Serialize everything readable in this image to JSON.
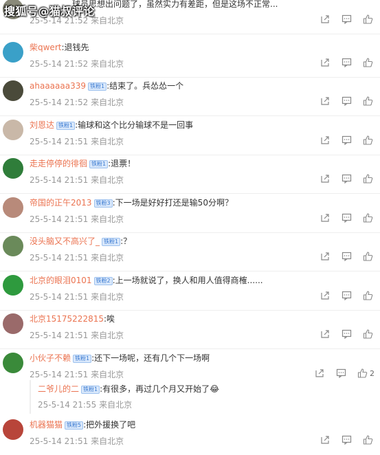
{
  "watermark": "搜狐号@猫叔评论",
  "comments": [
    {
      "username": "",
      "badge": "",
      "text": "球员思想出问题了，虽然实力有差距，但是这场不正常...",
      "time": "25-5-14 21:52",
      "location": "来自北京",
      "avatar_color": "#8a8a7a"
    },
    {
      "username": "柴qwert",
      "badge": "",
      "text": ":退钱先",
      "time": "25-5-14 21:52",
      "location": "来自北京",
      "avatar_color": "#3aa0c8"
    },
    {
      "username": "ahaaaaaa339",
      "badge": "铁粉1",
      "text": ":结束了。兵怂怂一个",
      "time": "25-5-14 21:52",
      "location": "来自北京",
      "avatar_color": "#4a4a3a"
    },
    {
      "username": "刘恩达",
      "badge": "铁粉1",
      "text": ":输球和这个比分输球不是一回事",
      "time": "25-5-14 21:51",
      "location": "来自北京",
      "avatar_color": "#c9b8a8"
    },
    {
      "username": "走走停停的徘徊",
      "badge": "铁粉1",
      "text": ":退票！",
      "time": "25-5-14 21:51",
      "location": "来自北京",
      "avatar_color": "#2f7d3a"
    },
    {
      "username": "帝国的正午2013",
      "badge": "铁粉3",
      "text": ":下一场是好好打还是输50分啊？",
      "time": "25-5-14 21:51",
      "location": "来自北京",
      "avatar_color": "#b88a7a"
    },
    {
      "username": "没头脑又不高兴了_",
      "badge": "铁粉1",
      "text": ":？",
      "time": "25-5-14 21:51",
      "location": "来自北京",
      "avatar_color": "#6a8a5a"
    },
    {
      "username": "北京的眼泪0101",
      "badge": "铁粉2",
      "text": ":上一场就说了，换人和用人值得商榷......",
      "time": "25-5-14 21:51",
      "location": "来自北京",
      "avatar_color": "#2e9a3e"
    },
    {
      "username": "北京15175222815",
      "badge": "",
      "text": ":唉",
      "time": "25-5-14 21:51",
      "location": "来自北京",
      "avatar_color": "#9a6a6a"
    },
    {
      "username": "小伙子不赖",
      "badge": "铁粉1",
      "text": ":还下一场呢，还有几个下一场啊",
      "time": "25-5-14 21:51",
      "location": "来自北京",
      "avatar_color": "#3a8a3a",
      "likes": "2"
    },
    {
      "username": "机器猫猫",
      "badge": "铁粉5",
      "text": ":把外援换了吧",
      "time": "25-5-14 21:51",
      "location": "来自北京",
      "avatar_color": "#b8453a"
    }
  ],
  "reply": {
    "username": "二爷儿的二",
    "badge": "铁粉1",
    "text": ":有很多，再过几个月又开始了",
    "emoji": "😂",
    "time": "25-5-14 21:55",
    "location": "来自北京"
  },
  "icons": [
    "share-icon",
    "comment-icon",
    "like-icon"
  ]
}
